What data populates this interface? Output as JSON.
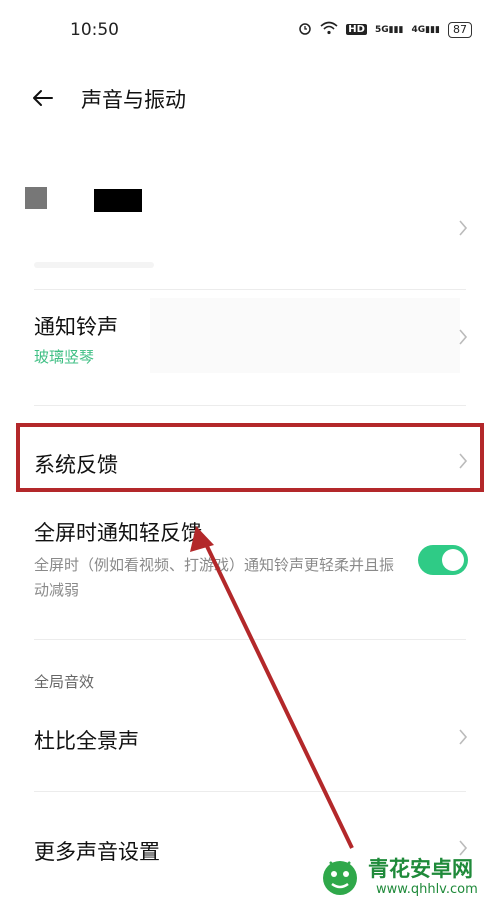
{
  "status_bar": {
    "time": "10:50",
    "hd": "HD",
    "net1": "5G",
    "net2": "4G",
    "battery": "87"
  },
  "header": {
    "title": "声音与振动"
  },
  "rows": {
    "notification_ringtone": {
      "title": "通知铃声",
      "value": "玻璃竖琴"
    },
    "system_feedback": {
      "title": "系统反馈"
    },
    "fullscreen_feedback": {
      "title": "全屏时通知轻反馈",
      "description": "全屏时（例如看视频、打游戏）通知铃声更轻柔并且振动减弱",
      "toggle_on": true
    }
  },
  "sections": {
    "global_audio": "全局音效"
  },
  "rows2": {
    "dolby": {
      "title": "杜比全景声"
    },
    "more_sound": {
      "title": "更多声音设置"
    }
  },
  "colors": {
    "accent": "#2fcb86",
    "highlight": "#b3282a"
  },
  "watermark": {
    "name": "青花安卓网",
    "url": "www.qhhlv.com"
  }
}
